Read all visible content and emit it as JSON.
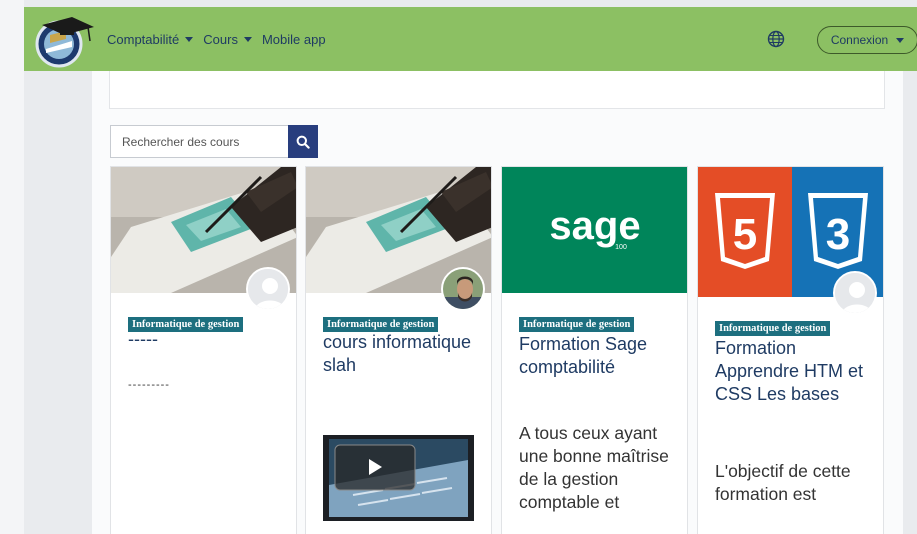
{
  "navbar": {
    "menu": [
      {
        "label": "Comptabilité",
        "dropdown": true
      },
      {
        "label": "Cours",
        "dropdown": true
      },
      {
        "label": "Mobile app",
        "dropdown": false
      }
    ],
    "language_icon": "globe-icon",
    "login_label": "Connexion"
  },
  "search": {
    "placeholder": "Rechercher des cours",
    "button_icon": "search-icon"
  },
  "courses": [
    {
      "category": "Informatique de gestion",
      "title": "-----",
      "summary": "---------",
      "image": "drawing-hand-photo",
      "avatar": "default-user-avatar"
    },
    {
      "category": "Informatique de gestion",
      "title": "cours informatique slah",
      "image": "drawing-hand-photo",
      "avatar": "teacher-photo",
      "media": "video-thumbnail"
    },
    {
      "category": "Informatique de gestion",
      "title": "Formation Sage comptabilité",
      "summary": "A tous ceux ayant une bonne maîtrise de la gestion comptable et",
      "image": "sage-logo",
      "logo_text": "sage",
      "logo_subtext": "100"
    },
    {
      "category": "Informatique de gestion",
      "title": "Formation Apprendre HTM et CSS Les bases",
      "summary": "L'objectif de cette formation est",
      "image": "html5-css3-logos",
      "avatar": "default-user-avatar",
      "logo_html": "5",
      "logo_css": "3"
    }
  ],
  "colors": {
    "navbar": "#8cc063",
    "accent": "#283e7e",
    "badge": "#1d6f7f",
    "sage_green": "#00855a",
    "html_orange": "#e44d26",
    "css_blue": "#1572b6"
  }
}
